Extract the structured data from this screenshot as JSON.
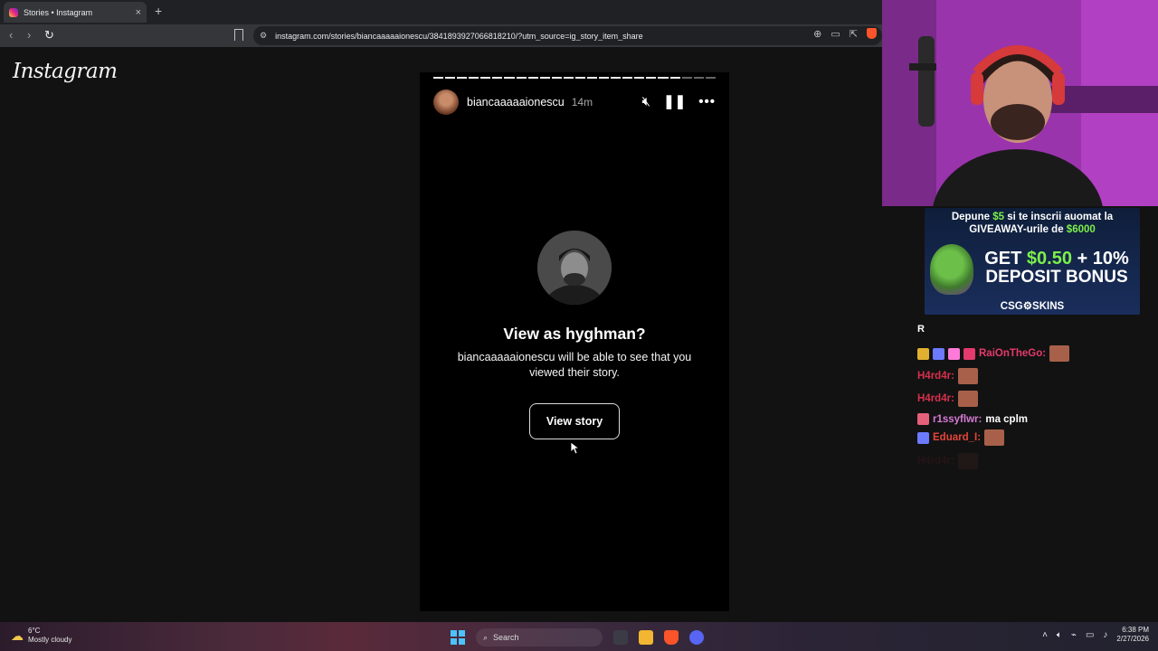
{
  "browser": {
    "tab_title": "Stories • Instagram",
    "tab_close": "×",
    "new_tab": "+",
    "url": "instagram.com/stories/biancaaaaaionescu/3841893927066818210/?utm_source=ig_story_item_share"
  },
  "instagram": {
    "logo": "Instagram",
    "story": {
      "username": "biancaaaaaionescu",
      "time": "14m",
      "progress_segments": 24,
      "progress_watched": 21,
      "prompt_title": "View as hyghman?",
      "prompt_body": "biancaaaaaionescu will be able to see that you viewed their story.",
      "view_button": "View story"
    }
  },
  "ad": {
    "line1_pre": "Depune ",
    "line1_amount": "$5",
    "line1_post": " si te inscrii auomat la",
    "line2_pre": "GIVEAWAY-urile de ",
    "line2_amount": "$6000",
    "big_line1_pre": "GET ",
    "big_line1_amount": "$0.50",
    "big_line1_post": " + 10%",
    "big_line2": "DEPOSIT BONUS",
    "brand": "CSG⚙SKINS"
  },
  "chat": {
    "header_letter": "R",
    "messages": [
      {
        "user": "RaiOnTheGo:",
        "color": "#e53a6e",
        "text": "",
        "badges": [
          "#e0b030",
          "#6c7aff",
          "#ff7ad9",
          "#e53a6e"
        ],
        "emote": true
      },
      {
        "user": "H4rd4r:",
        "color": "#d6304c",
        "text": "",
        "badges": [],
        "emote": true
      },
      {
        "user": "H4rd4r:",
        "color": "#d6304c",
        "text": "",
        "badges": [],
        "emote": true
      },
      {
        "user": "r1ssyflwr:",
        "color": "#d67ad6",
        "text": "ma cplm",
        "badges": [
          "#e5607a"
        ],
        "emote": false
      },
      {
        "user": "Eduard_I:",
        "color": "#e5453a",
        "text": "",
        "badges": [
          "#6c7aff"
        ],
        "emote": true
      },
      {
        "user": "H4rd4r:",
        "color": "#4a1a22",
        "text": "",
        "badges": [],
        "emote": true
      }
    ]
  },
  "taskbar": {
    "weather_temp": "6°C",
    "weather_desc": "Mostly cloudy",
    "search_label": "Search",
    "time": "6:38 PM",
    "date": "2/27/2026"
  }
}
